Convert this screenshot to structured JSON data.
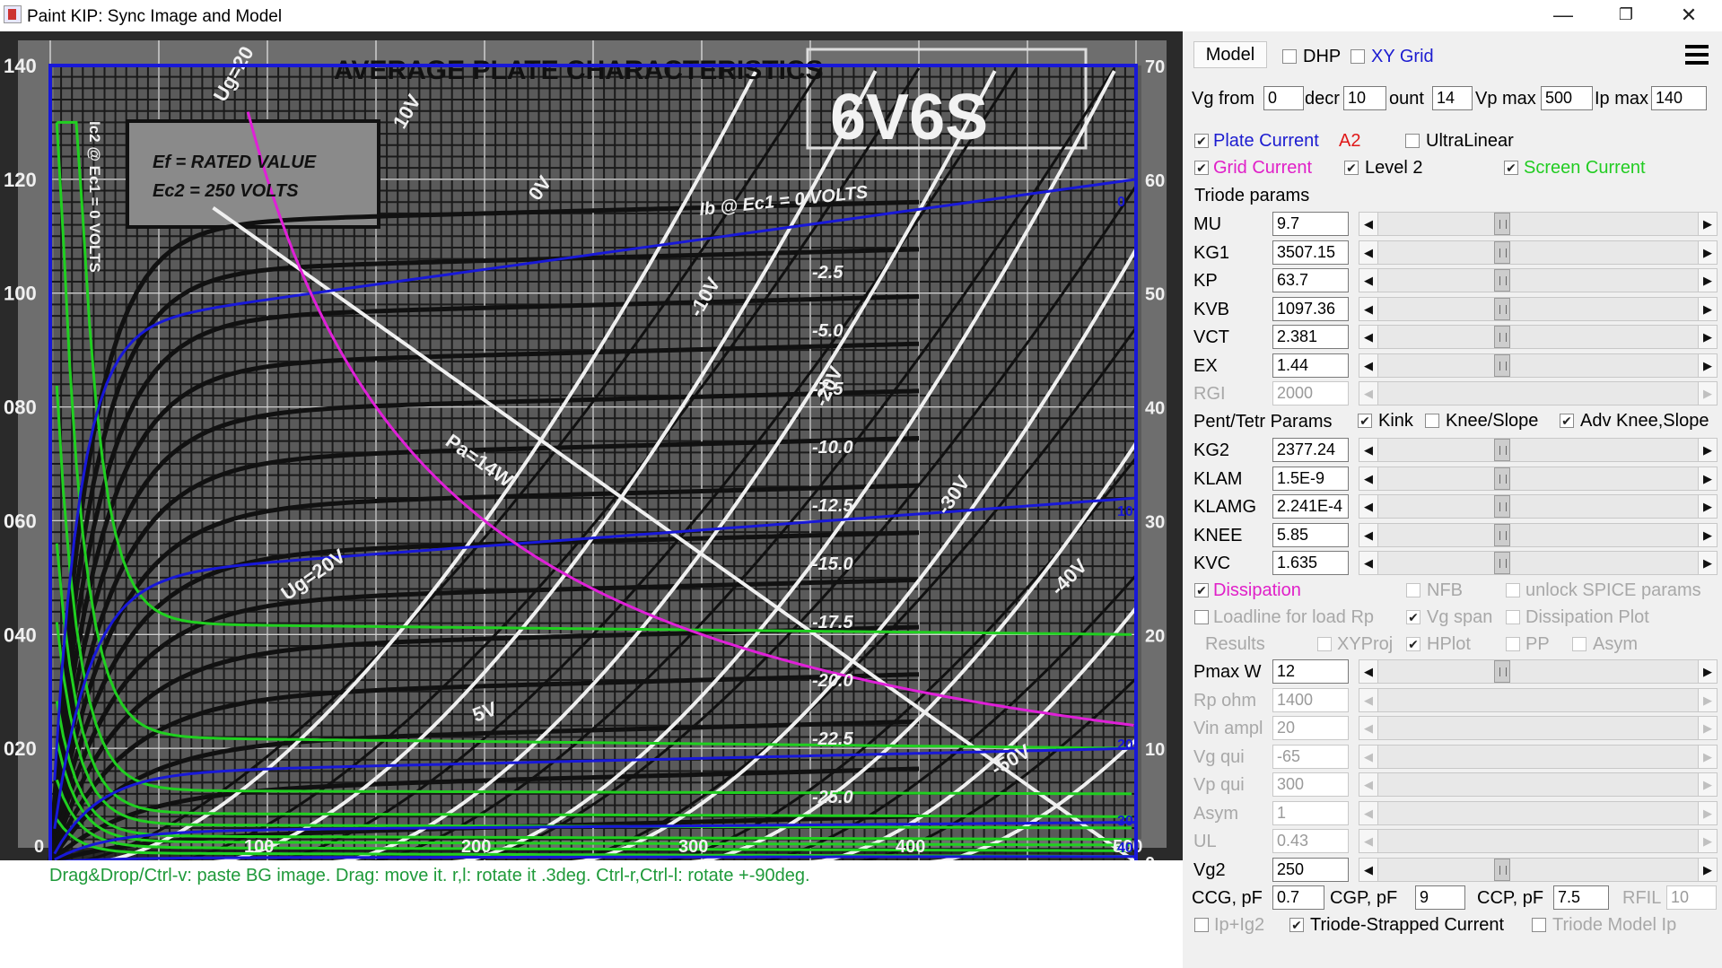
{
  "window": {
    "title": "Paint KIP: Sync Image and Model"
  },
  "plot": {
    "title": "AVERAGE PLATE CHARACTERISTICS",
    "tube": "6V6S",
    "note_line1": "Ef = RATED VALUE",
    "note_line2": "Ec2 = 250 VOLTS",
    "ib_label": "Ib @ Ec1 = 0 VOLTS",
    "ic2_label": "Ic2 @ Ec1 = 0 VOLTS",
    "pa_label": "Pa=14W",
    "vg2_label": "Ug=20V",
    "x_ticks": [
      "0",
      "100",
      "200",
      "300",
      "400",
      "500"
    ],
    "left_ticks": [
      "140",
      "120",
      "100",
      "080",
      "060",
      "040",
      "020"
    ],
    "right_ticks": [
      "70",
      "60",
      "50",
      "40",
      "30",
      "20",
      "10",
      "0"
    ],
    "bias_labels": [
      "-2.5",
      "-5.0",
      "-7.5",
      "-10.0",
      "-12.5",
      "-15.0",
      "-17.5",
      "-20.0",
      "-22.5",
      "-25.0"
    ],
    "diag_labels": [
      "0V",
      "-10V",
      "-20V",
      "-30V",
      "-40V",
      "-50V",
      "10V",
      "5V",
      "Ug=20"
    ],
    "blue_labels": [
      "0",
      "10",
      "20",
      "30",
      "40"
    ],
    "colors": {
      "blue": "#1818d8",
      "green": "#20d020",
      "magenta": "#e020d8",
      "white": "#f0f0f0",
      "black": "#111111"
    }
  },
  "status": {
    "hint": "Drag&Drop/Ctrl-v: paste BG image. Drag: move it. r,l: rotate it .3deg. Ctrl-r,Ctrl-l: rotate +-90deg."
  },
  "panel": {
    "model_button": "Model",
    "dhp_label": "DHP",
    "xy_grid_label": "XY Grid",
    "vg_from_label": "Vg from",
    "vg_from_value": "0",
    "decr_label": "decr",
    "decr_value": "10",
    "count_label": "ount",
    "count_value": "14",
    "vp_max_label": "Vp max",
    "vp_max_value": "500",
    "ip_max_label": "Ip max",
    "ip_max_value": "140",
    "plate_current_label": "Plate Current",
    "a2_label": "A2",
    "ultralinear_label": "UltraLinear",
    "grid_current_label": "Grid Current",
    "level2_label": "Level 2",
    "screen_current_label": "Screen Current",
    "triode_params_label": "Triode params",
    "triode_params": [
      {
        "name": "MU",
        "value": "9.7",
        "enabled": true
      },
      {
        "name": "KG1",
        "value": "3507.15",
        "enabled": true
      },
      {
        "name": "KP",
        "value": "63.7",
        "enabled": true
      },
      {
        "name": "KVB",
        "value": "1097.36",
        "enabled": true
      },
      {
        "name": "VCT",
        "value": "2.381",
        "enabled": true
      },
      {
        "name": "EX",
        "value": "1.44",
        "enabled": true
      },
      {
        "name": "RGI",
        "value": "2000",
        "enabled": false
      }
    ],
    "pent_params_label": "Pent/Tetr Params",
    "kink_label": "Kink",
    "knee_slope_label": "Knee/Slope",
    "adv_knee_label": "Adv Knee,Slope",
    "pent_params": [
      {
        "name": "KG2",
        "value": "2377.24",
        "enabled": true
      },
      {
        "name": "KLAM",
        "value": "1.5E-9",
        "enabled": true
      },
      {
        "name": "KLAMG",
        "value": "2.241E-4",
        "enabled": true
      },
      {
        "name": "KNEE",
        "value": "5.85",
        "enabled": true
      },
      {
        "name": "KVC",
        "value": "1.635",
        "enabled": true
      }
    ],
    "dissipation_label": "Dissipation",
    "nfb_label": "NFB",
    "unlock_spice_label": "unlock SPICE params",
    "loadline_label": "Loadline for load Rp",
    "vg_span_label": "Vg span",
    "dissipation_plot_label": "Dissipation Plot",
    "results_label": "Results",
    "xyproj_label": "XYProj",
    "hplot_label": "HPlot",
    "pp_label": "PP",
    "asym_check_label": "Asym",
    "load_params": [
      {
        "name": "Pmax W",
        "value": "12",
        "enabled": true
      },
      {
        "name": "Rp ohm",
        "value": "1400",
        "enabled": false
      },
      {
        "name": "Vin ampl",
        "value": "20",
        "enabled": false
      },
      {
        "name": "Vg qui",
        "value": "-65",
        "enabled": false
      },
      {
        "name": "Vp qui",
        "value": "300",
        "enabled": false
      },
      {
        "name": "Asym",
        "value": "1",
        "enabled": false
      },
      {
        "name": "UL",
        "value": "0.43",
        "enabled": false
      },
      {
        "name": "Vg2",
        "value": "250",
        "enabled": true
      }
    ],
    "ccg_label": "CCG, pF",
    "ccg_value": "0.7",
    "cgp_label": "CGP, pF",
    "cgp_value": "9",
    "ccp_label": "CCP, pF",
    "ccp_value": "7.5",
    "rfil_label": "RFIL",
    "rfil_value": "10",
    "ip_ig2_label": "Ip+Ig2",
    "triode_strapped_label": "Triode-Strapped Current",
    "triode_model_ip_label": "Triode Model Ip"
  }
}
